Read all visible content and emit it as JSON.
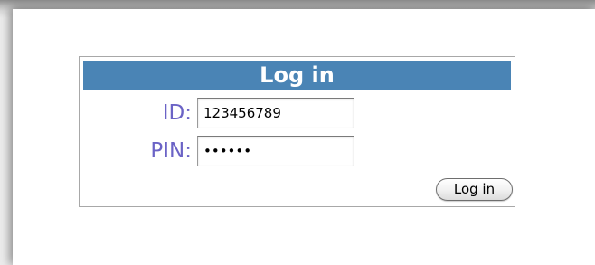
{
  "login": {
    "title": "Log in",
    "id_label": "ID:",
    "id_value": "123456789",
    "pin_label": "PIN:",
    "pin_value": "123456",
    "button_label": "Log in"
  },
  "colors": {
    "header_bg": "#4a84b5",
    "label_color": "#6b63c6"
  }
}
